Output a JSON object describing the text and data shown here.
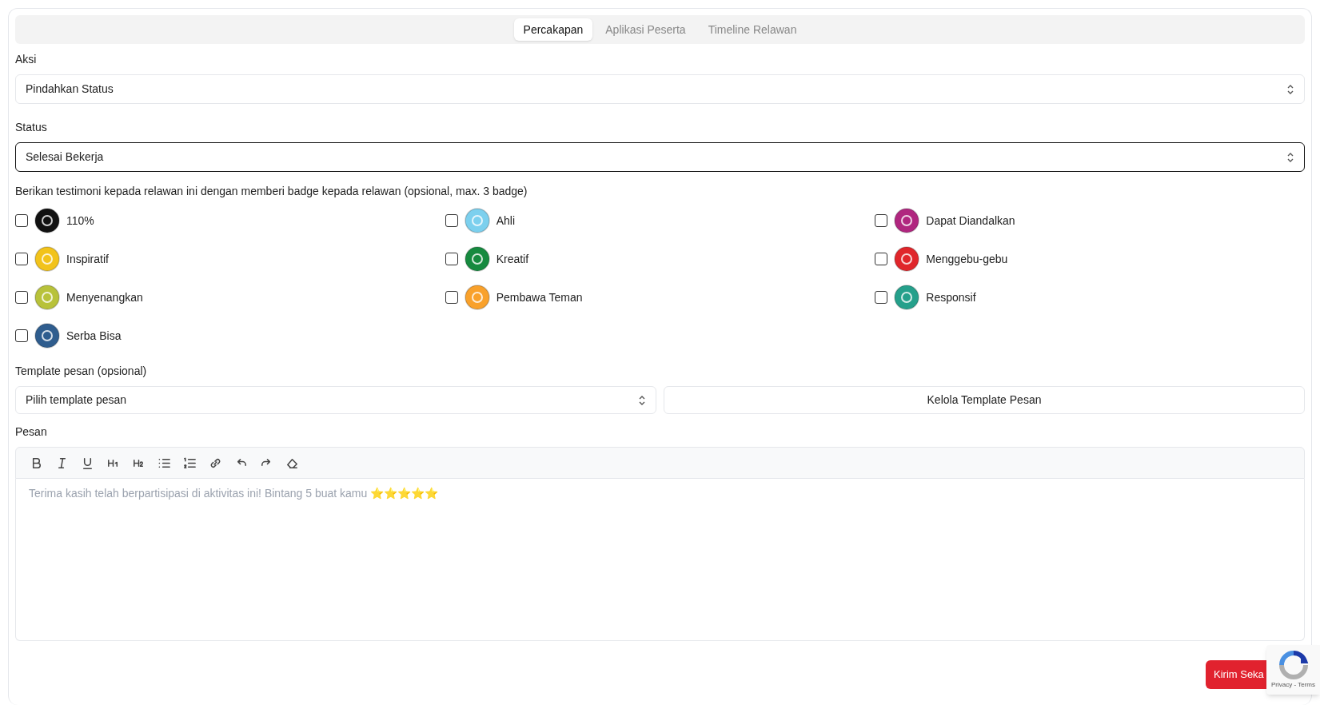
{
  "tabs": [
    {
      "label": "Percakapan",
      "selected": true
    },
    {
      "label": "Aplikasi Peserta",
      "selected": false
    },
    {
      "label": "Timeline Relawan",
      "selected": false
    }
  ],
  "action": {
    "label": "Aksi",
    "value": "Pindahkan Status",
    "focused": false
  },
  "status": {
    "label": "Status",
    "value": "Selesai Bekerja",
    "focused": true
  },
  "badges": {
    "label": "Berikan testimoni kepada relawan ini dengan memberi badge kepada relawan (opsional, max. 3 badge)",
    "items": [
      {
        "name": "110%",
        "checked": false,
        "color": "#111111"
      },
      {
        "name": "Ahli",
        "checked": false,
        "color": "#7cd0ee"
      },
      {
        "name": "Dapat Diandalkan",
        "checked": false,
        "color": "#b0267f"
      },
      {
        "name": "Inspiratif",
        "checked": false,
        "color": "#f2c31b"
      },
      {
        "name": "Kreatif",
        "checked": false,
        "color": "#168a3f"
      },
      {
        "name": "Menggebu-gebu",
        "checked": false,
        "color": "#e0262b"
      },
      {
        "name": "Menyenangkan",
        "checked": false,
        "color": "#b8c23a"
      },
      {
        "name": "Pembawa Teman",
        "checked": false,
        "color": "#f9a12b"
      },
      {
        "name": "Responsif",
        "checked": false,
        "color": "#25a08b"
      },
      {
        "name": "Serba Bisa",
        "checked": false,
        "color": "#2f5d8e"
      }
    ]
  },
  "template": {
    "label": "Template pesan (opsional)",
    "placeholder": "Pilih template pesan",
    "manage_button": "Kelola Template Pesan"
  },
  "message": {
    "label": "Pesan",
    "toolbar": [
      {
        "kind": "bold"
      },
      {
        "kind": "italic"
      },
      {
        "kind": "underline"
      },
      {
        "kind": "h1"
      },
      {
        "kind": "h2"
      },
      {
        "kind": "bullet-list"
      },
      {
        "kind": "numbered-list"
      },
      {
        "kind": "link"
      },
      {
        "kind": "undo"
      },
      {
        "kind": "redo"
      },
      {
        "kind": "eraser"
      }
    ],
    "placeholder": "Terima kasih telah berpartisipasi di aktivitas ini! Bintang 5 buat kamu ⭐⭐⭐⭐⭐"
  },
  "submit_button": "Kirim Seka",
  "recaptcha": {
    "links": "Privacy - Terms"
  }
}
